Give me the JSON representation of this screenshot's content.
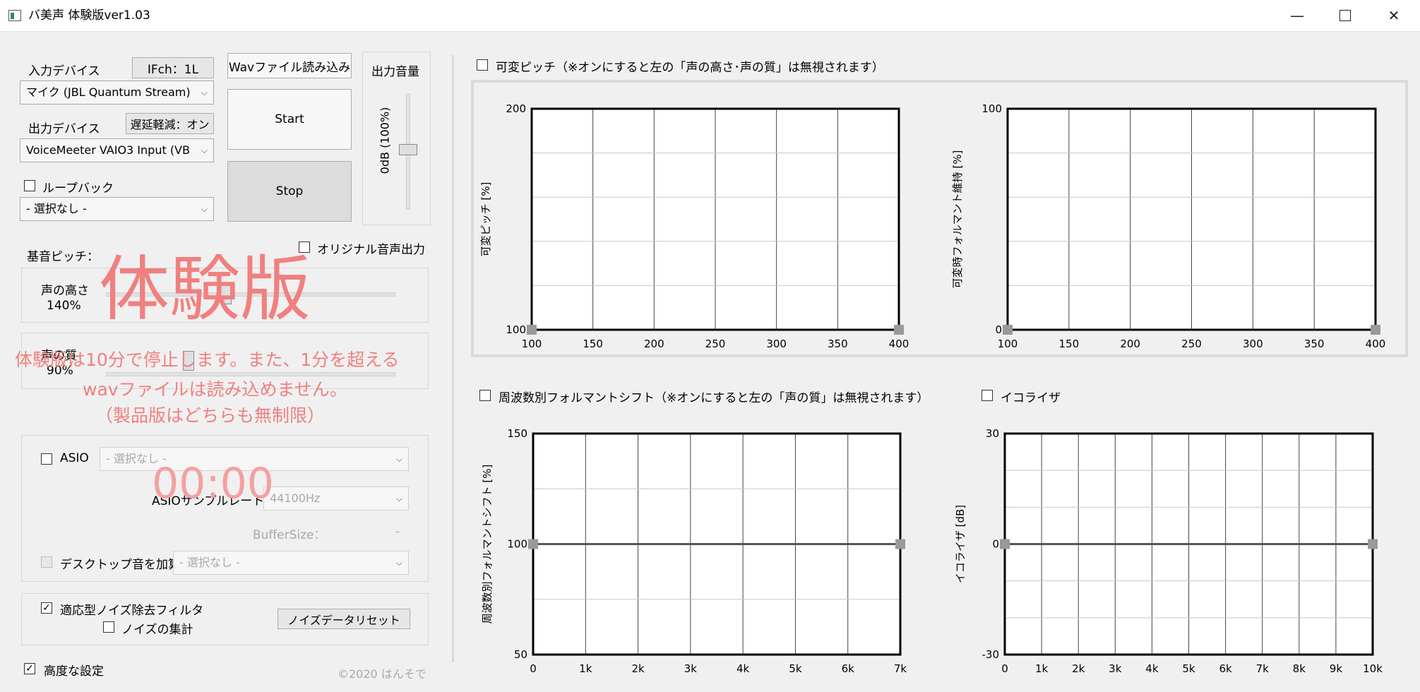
{
  "window": {
    "title": "バ美声 体験版ver1.03"
  },
  "left": {
    "input_device_label": "入力デバイス",
    "ifch_button": "IFch：1L",
    "input_device_value": "マイク (JBL Quantum Stream)",
    "output_device_label": "出力デバイス",
    "latency_button": "遅延軽減：オン",
    "output_device_value": "VoiceMeeter VAIO3 Input (VB",
    "loopback_label": "ループバック",
    "loopback_select": "- 選択なし -",
    "wav_button": "Wavファイル読み込み",
    "start_button": "Start",
    "stop_button": "Stop",
    "volume_title": "出力音量",
    "volume_value": "0dB (100%)",
    "original_output_label": "オリジナル音声出力",
    "base_pitch_label": "基音ピッチ：",
    "pitch_label": "声の高さ",
    "pitch_value": "140%",
    "quality_label": "声の質",
    "quality_value": "90%",
    "asio_label": "ASIO",
    "asio_select": "- 選択なし -",
    "asio_rate_label": "ASIOサンプルレート：",
    "asio_rate_value": "44100Hz",
    "buffer_label": "BufferSize：",
    "buffer_value": "-",
    "desktop_label": "デスクトップ音を加算",
    "desktop_select": "- 選択なし -",
    "adaptive_label": "適応型ノイズ除去フィルタ",
    "noise_sum_label": "ノイズの集計",
    "noise_reset_button": "ノイズデータリセット",
    "advanced_label": "高度な設定",
    "copyright": "©2020 はんそで"
  },
  "watermark": {
    "big": "体験版",
    "line1": "体験版は10分で停止します。また、1分を超える",
    "line2": "wavファイルは読み込めません。",
    "line3": "（製品版はどちらも無制限）",
    "timer": "00:00"
  },
  "right": {
    "variable_pitch_label": "可変ピッチ（※オンにすると左の「声の高さ･声の質」は無視されます）",
    "formant_shift_label": "周波数別フォルマントシフト（※オンにすると左の「声の質」は無視されます）",
    "equalizer_label": "イコライザ"
  },
  "colors": {
    "watermark": "#f08080",
    "plot_line": "#555555",
    "handle": "#999999"
  },
  "chart_data": [
    {
      "type": "line",
      "ylabel": "可変ピッチ [%]",
      "xlim": [
        100,
        400
      ],
      "ylim": [
        100,
        200
      ],
      "y_ticks": [
        "200",
        "100"
      ],
      "x_ticks": [
        "100",
        "150",
        "200",
        "250",
        "300",
        "350",
        "400"
      ],
      "x_grid": 6,
      "y_grid": 5,
      "handles": [
        {
          "x": 100,
          "y": 100
        },
        {
          "x": 400,
          "y": 100
        }
      ],
      "line": []
    },
    {
      "type": "line",
      "ylabel": "可変時フォルマント維持 [%]",
      "xlim": [
        100,
        400
      ],
      "ylim": [
        0,
        100
      ],
      "y_ticks": [
        "100",
        "0"
      ],
      "x_ticks": [
        "100",
        "150",
        "200",
        "250",
        "300",
        "350",
        "400"
      ],
      "x_grid": 6,
      "y_grid": 5,
      "handles": [
        {
          "x": 100,
          "y": 0
        },
        {
          "x": 400,
          "y": 0
        }
      ],
      "line": []
    },
    {
      "type": "line",
      "ylabel": "周波数別フォルマントシフト [%]",
      "xlim": [
        0,
        7
      ],
      "ylim": [
        50,
        150
      ],
      "y_ticks": [
        "150",
        "100",
        "50"
      ],
      "x_ticks": [
        "0",
        "1k",
        "2k",
        "3k",
        "4k",
        "5k",
        "6k",
        "7k"
      ],
      "x_grid": 7,
      "y_grid": 4,
      "handles": [
        {
          "x": 0,
          "y": 100
        },
        {
          "x": 7,
          "y": 100
        }
      ],
      "line": [
        {
          "x": 0,
          "y": 100
        },
        {
          "x": 7,
          "y": 100
        }
      ]
    },
    {
      "type": "line",
      "ylabel": "イコライザ [dB]",
      "xlim": [
        0,
        10
      ],
      "ylim": [
        -30,
        30
      ],
      "y_ticks": [
        "30",
        "0",
        "-30"
      ],
      "x_ticks": [
        "0",
        "1k",
        "2k",
        "3k",
        "4k",
        "5k",
        "6k",
        "7k",
        "8k",
        "9k",
        "10k"
      ],
      "x_grid": 10,
      "y_grid": 6,
      "handles": [
        {
          "x": 0,
          "y": 0
        },
        {
          "x": 10,
          "y": 0
        }
      ],
      "line": [
        {
          "x": 0,
          "y": 0
        },
        {
          "x": 10,
          "y": 0
        }
      ]
    }
  ]
}
